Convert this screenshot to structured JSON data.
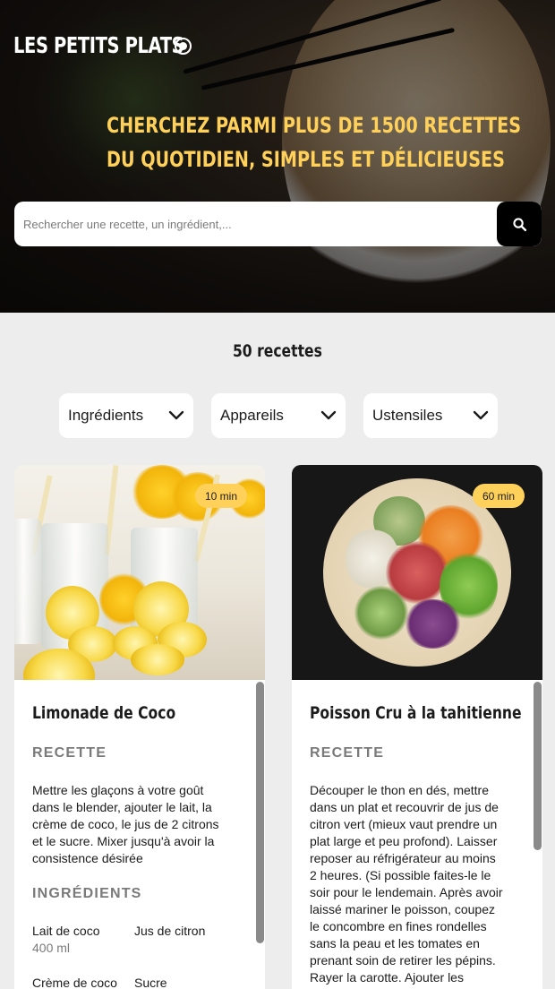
{
  "header": {
    "logo": "LES PETITS PLATS",
    "headline_line1": "CHERCHEZ PARMI PLUS DE 1500 RECETTES",
    "headline_line2": "DU QUOTIDIEN, SIMPLES ET DÉLICIEUSES",
    "search_placeholder": "Rechercher une recette, un ingrédient,...",
    "search_icon": "search-icon"
  },
  "results": {
    "count_label": "50 recettes"
  },
  "filters": [
    {
      "label": "Ingrédients",
      "icon": "chevron-down-icon"
    },
    {
      "label": "Appareils",
      "icon": "chevron-down-icon"
    },
    {
      "label": "Ustensiles",
      "icon": "chevron-down-icon"
    }
  ],
  "recipes": [
    {
      "time": "10 min",
      "title": "Limonade de Coco",
      "recipe_heading": "RECETTE",
      "description_lines": [
        "Mettre les glaçons à votre goût",
        "dans le blender, ajouter le lait, la",
        "crème de coco, le jus de 2 citrons",
        "et le sucre. Mixer jusqu'à avoir la",
        "consistence désirée"
      ],
      "ingredients_heading": "INGRÉDIENTS",
      "ingredients": [
        {
          "name": "Lait de coco",
          "qty": "400 ml"
        },
        {
          "name": "Jus de citron",
          "qty": ""
        },
        {
          "name": "Crème de coco",
          "qty": ""
        },
        {
          "name": "Sucre",
          "qty": ""
        }
      ]
    },
    {
      "time": "60 min",
      "title": "Poisson Cru à la tahitienne",
      "recipe_heading": "RECETTE",
      "description_lines": [
        "Découper le thon en dés, mettre",
        "dans un plat et recouvrir de jus de",
        "citron vert (mieux vaut prendre un",
        "plat large et peu profond). Laisser",
        "reposer au réfrigérateur au moins",
        "2 heures. (Si possible faites-le le",
        "soir pour le lendemain. Après avoir",
        "laissé mariner le poisson, coupez",
        "le concombre en fines rondelles",
        "sans la peau et les tomates en",
        "prenant soin de retirer les pépins.",
        "Rayer la carotte. Ajouter les"
      ]
    }
  ],
  "colors": {
    "accent": "#ffd15b",
    "text": "#1b1b1b",
    "muted": "#7a7a7a",
    "background": "#ededed"
  }
}
